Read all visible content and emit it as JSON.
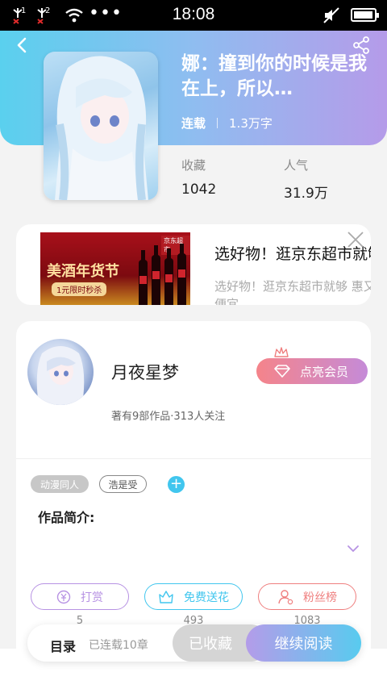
{
  "status_bar": {
    "time": "18:08",
    "sim1": "1",
    "sim2": "2",
    "more": "•••",
    "icons": [
      "signal-icon",
      "wifi-icon",
      "mute-icon",
      "battery-icon"
    ],
    "battery_level": 0.95
  },
  "book": {
    "title": "娜：撞到你的时候是我在上，所以…",
    "status": "连载",
    "word_count": "1.3万字",
    "favorites_label": "收藏",
    "favorites_value": "1042",
    "popularity_label": "人气",
    "popularity_value": "31.9万"
  },
  "ad": {
    "title": "选好物！逛京东超市就够",
    "description": "选好物！逛京东超市就够 惠又便宜",
    "banner_text": "美酒年货节",
    "banner_sub": "1元限时秒杀",
    "logo": "京东超市"
  },
  "author": {
    "name": "月夜星梦",
    "vip_label": "点亮会员",
    "meta": "著有9部作品·313人关注",
    "tags": [
      "动漫同人",
      "浩是受"
    ],
    "add_tag": "+",
    "intro_label": "作品简介:"
  },
  "actions": [
    {
      "label": "打赏",
      "count": "5",
      "icon": "coin-icon"
    },
    {
      "label": "免费送花",
      "count": "493",
      "icon": "flower-icon"
    },
    {
      "label": "粉丝榜",
      "count": "1083",
      "icon": "fans-icon"
    }
  ],
  "bottom_bar": {
    "toc_label": "目录",
    "chapters": "已连载10章",
    "collected_label": "已收藏",
    "read_label": "继续阅读"
  },
  "colors": {
    "header_start": "#5ad0ee",
    "header_end": "#b59be9",
    "accent_blue": "#41c6ee",
    "accent_purple": "#b792e3",
    "accent_red": "#ef7f7f"
  }
}
